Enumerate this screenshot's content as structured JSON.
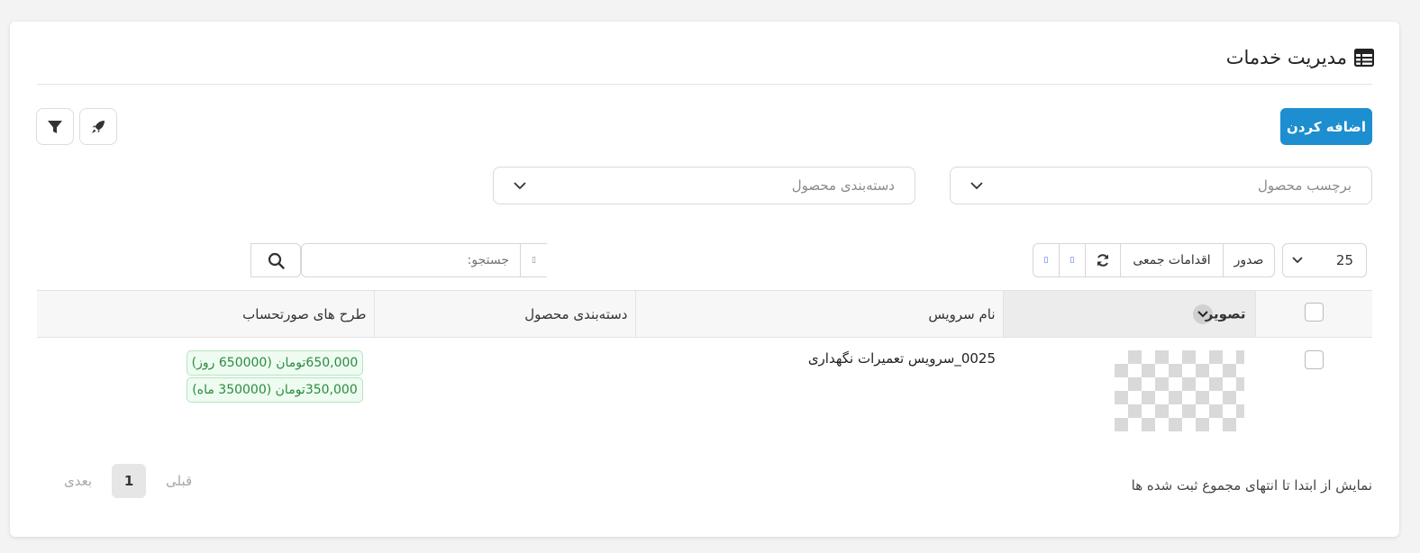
{
  "header": {
    "title": "مدیریت خدمات",
    "icon": "table-icon"
  },
  "actions": {
    "add_label": "اضافه کردن"
  },
  "filters": {
    "tag_placeholder": "برچسب محصول",
    "category_placeholder": "دسته‌بندی محصول"
  },
  "toolbar": {
    "page_length": "25",
    "export_label": "صدور",
    "bulk_label": "اقدامات جمعی",
    "col_a": "▯",
    "col_b": "▯"
  },
  "search": {
    "placeholder": "جستجو:",
    "extra": "▯"
  },
  "table": {
    "headers": {
      "image": "تصویر",
      "name": "نام سرویس",
      "category": "دسته‌بندی محصول",
      "plans": "طرح های صورتحساب"
    },
    "rows": [
      {
        "name": "0025_سرویس تعمیرات نگهداری",
        "category": "",
        "plans": [
          "650,000تومان (650000 روز)",
          "350,000تومان (350000 ماه)"
        ]
      }
    ]
  },
  "footer": {
    "info": "نمایش از ابتدا تا انتهای مجموع ثبت شده ها",
    "prev": "قبلی",
    "current_page": "1",
    "next": "بعدی"
  },
  "colors": {
    "primary": "#1d8ecf",
    "badge_green": "#2a8c3f"
  }
}
